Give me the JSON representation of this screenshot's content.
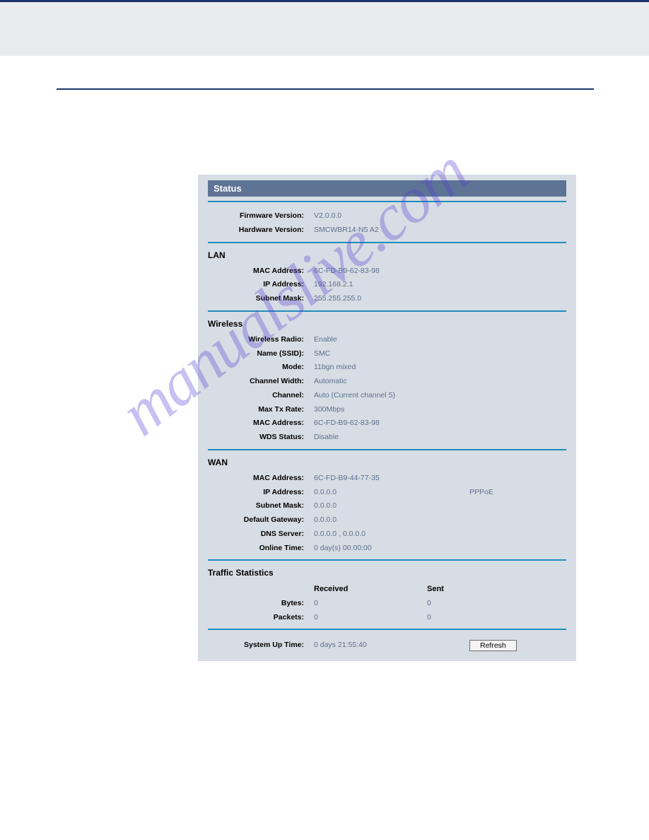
{
  "watermark": "manualslive.com",
  "status": {
    "title": "Status",
    "firmware_label": "Firmware Version:",
    "firmware_value": "V2.0.0.0",
    "hardware_label": "Hardware Version:",
    "hardware_value": "SMCWBR14-N5 A2"
  },
  "lan": {
    "heading": "LAN",
    "mac_label": "MAC Address:",
    "mac_value": "6C-FD-B9-62-83-98",
    "ip_label": "IP Address:",
    "ip_value": "192.168.2.1",
    "subnet_label": "Subnet Mask:",
    "subnet_value": "255.255.255.0"
  },
  "wireless": {
    "heading": "Wireless",
    "radio_label": "Wireless Radio:",
    "radio_value": "Enable",
    "ssid_label": "Name (SSID):",
    "ssid_value": "SMC",
    "mode_label": "Mode:",
    "mode_value": "11bgn mixed",
    "width_label": "Channel Width:",
    "width_value": "Automatic",
    "channel_label": "Channel:",
    "channel_value": "Auto (Current channel 5)",
    "maxtx_label": "Max Tx Rate:",
    "maxtx_value": "300Mbps",
    "mac_label": "MAC Address:",
    "mac_value": "6C-FD-B9-62-83-98",
    "wds_label": "WDS Status:",
    "wds_value": "Disable"
  },
  "wan": {
    "heading": "WAN",
    "mac_label": "MAC Address:",
    "mac_value": "6C-FD-B9-44-77-35",
    "ip_label": "IP Address:",
    "ip_value": "0.0.0.0",
    "ip_type": "PPPoE",
    "subnet_label": "Subnet Mask:",
    "subnet_value": "0.0.0.0",
    "gw_label": "Default Gateway:",
    "gw_value": "0.0.0.0",
    "dns_label": "DNS Server:",
    "dns_value": "0.0.0.0 , 0.0.0.0",
    "online_label": "Online Time:",
    "online_value": "0 day(s) 00:00:00"
  },
  "traffic": {
    "heading": "Traffic Statistics",
    "received_label": "Received",
    "sent_label": "Sent",
    "bytes_label": "Bytes:",
    "bytes_received": "0",
    "bytes_sent": "0",
    "packets_label": "Packets:",
    "packets_received": "0",
    "packets_sent": "0"
  },
  "uptime": {
    "label": "System Up Time:",
    "value": "0 days 21:55:40",
    "refresh_label": "Refresh"
  }
}
